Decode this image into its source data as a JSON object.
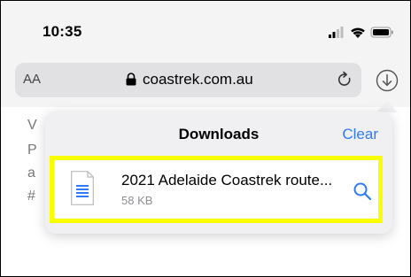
{
  "status_bar": {
    "time": "10:35",
    "icons": [
      "cellular-signal-icon",
      "wifi-icon",
      "battery-icon"
    ]
  },
  "address_bar": {
    "text_size_label": "AA",
    "domain": "coastrek.com.au",
    "icons": [
      "lock-icon",
      "reload-icon"
    ]
  },
  "toolbar": {
    "download_icon": "download-arrow-icon"
  },
  "page_background_text": [
    "V",
    "P",
    "a",
    "#"
  ],
  "downloads_popover": {
    "title": "Downloads",
    "clear_label": "Clear",
    "items": [
      {
        "name": "2021 Adelaide Coastrek route...",
        "size": "58 KB",
        "icon": "document-icon",
        "action_icon": "magnifying-glass-icon"
      }
    ]
  },
  "colors": {
    "accent": "#2f7bf5",
    "highlight_border": "#f7ff00",
    "popover_bg": "#f0f0f2",
    "url_bar_bg": "#e1e1e4"
  }
}
